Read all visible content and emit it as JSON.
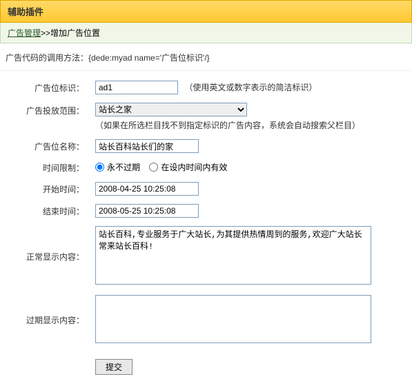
{
  "header": {
    "title": "辅助插件"
  },
  "breadcrumb": {
    "link_text": "广告管理",
    "sep": ">>",
    "current": "增加广告位置"
  },
  "hint": "广告代码的调用方法：{dede:myad name='广告位标识'/}",
  "form": {
    "identifier": {
      "label": "广告位标识：",
      "value": "ad1",
      "note": "（使用英文或数字表示的简洁标识）"
    },
    "scope": {
      "label": "广告投放范围：",
      "selected": "站长之家",
      "note": "（如果在所选栏目找不到指定标识的广告内容，系统会自动搜索父栏目）"
    },
    "name": {
      "label": "广告位名称：",
      "value": "站长百科站长们的家"
    },
    "time_limit": {
      "label": "时间限制：",
      "opt_never": "永不过期",
      "opt_range": "在设内时间内有效"
    },
    "start_time": {
      "label": "开始时间：",
      "value": "2008-04-25 10:25:08"
    },
    "end_time": {
      "label": "结束时间：",
      "value": "2008-05-25 10:25:08"
    },
    "normal_content": {
      "label": "正常显示内容：",
      "value": "站长百科,专业服务于广大站长,为其提供热情周到的服务,欢迎广大站长常来站长百科!"
    },
    "expired_content": {
      "label": "过期显示内容：",
      "value": ""
    },
    "submit": "提交"
  }
}
